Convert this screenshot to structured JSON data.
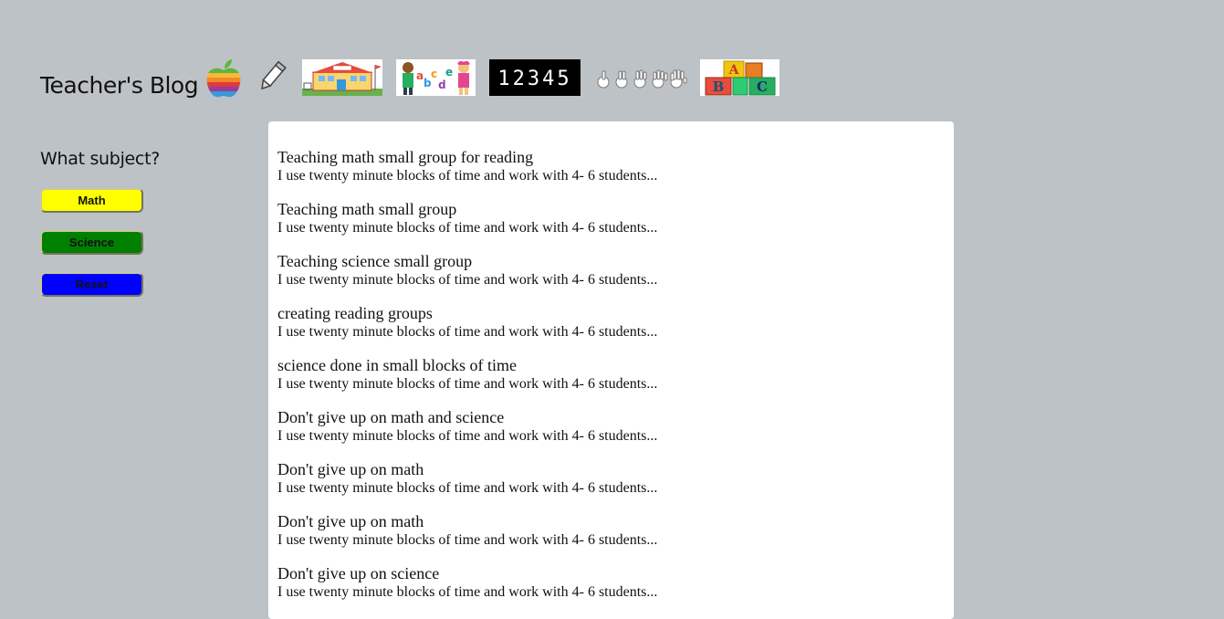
{
  "header": {
    "title": "Teacher's Blog",
    "images": [
      {
        "name": "apple-logo-icon"
      },
      {
        "name": "pencil-icon"
      },
      {
        "name": "school-building-image"
      },
      {
        "name": "kids-alphabet-image"
      },
      {
        "name": "numbers-12345-image",
        "text": "12345"
      },
      {
        "name": "counting-hands-image"
      },
      {
        "name": "abc-blocks-image",
        "letters": [
          "A",
          "B",
          "C"
        ]
      }
    ]
  },
  "sidebar": {
    "heading": "What subject?",
    "buttons": [
      {
        "label": "Math",
        "color": "#ffff00"
      },
      {
        "label": "Science",
        "color": "#008000"
      },
      {
        "label": "Reset",
        "color": "#0000ff"
      }
    ]
  },
  "posts": [
    {
      "title": "Teaching math small group for reading",
      "excerpt": "I use twenty minute blocks of time and work with 4- 6 students..."
    },
    {
      "title": "Teaching math small group",
      "excerpt": "I use twenty minute blocks of time and work with 4- 6 students..."
    },
    {
      "title": "Teaching science small group",
      "excerpt": "I use twenty minute blocks of time and work with 4- 6 students..."
    },
    {
      "title": "creating reading groups",
      "excerpt": "I use twenty minute blocks of time and work with 4- 6 students..."
    },
    {
      "title": "science done in small blocks of time",
      "excerpt": "I use twenty minute blocks of time and work with 4- 6 students..."
    },
    {
      "title": "Don't give up on math and science",
      "excerpt": "I use twenty minute blocks of time and work with 4- 6 students..."
    },
    {
      "title": "Don't give up on math",
      "excerpt": "I use twenty minute blocks of time and work with 4- 6 students..."
    },
    {
      "title": "Don't give up on math",
      "excerpt": "I use twenty minute blocks of time and work with 4- 6 students..."
    },
    {
      "title": "Don't give up on science",
      "excerpt": "I use twenty minute blocks of time and work with 4- 6 students..."
    }
  ]
}
